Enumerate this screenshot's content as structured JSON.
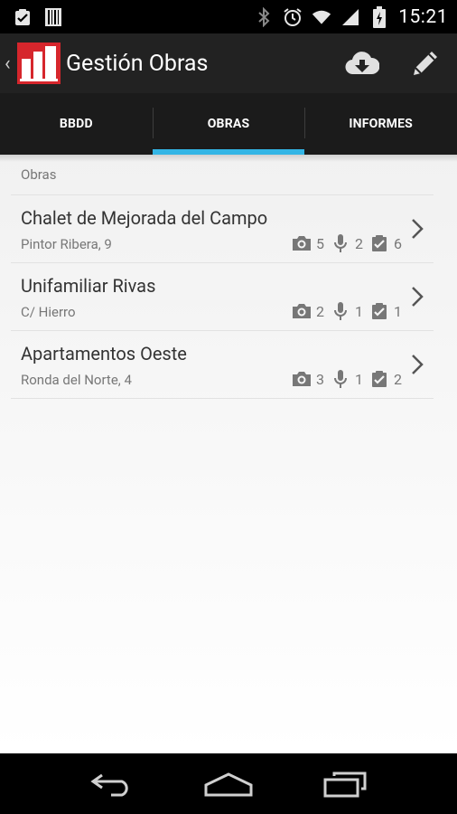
{
  "status_bar": {
    "time": "15:21",
    "left_icons": [
      "clipboard-check-icon",
      "barcode-icon"
    ],
    "right_icons": [
      "bluetooth-icon",
      "alarm-icon",
      "wifi-icon",
      "signal-icon",
      "battery-icon"
    ]
  },
  "action_bar": {
    "title": "Gestión Obras",
    "actions": [
      "download-cloud-icon",
      "pencil-icon"
    ]
  },
  "tabs": [
    {
      "label": "BBDD",
      "active": false
    },
    {
      "label": "OBRAS",
      "active": true
    },
    {
      "label": "INFORMES",
      "active": false
    }
  ],
  "section": {
    "header": "Obras"
  },
  "obras": [
    {
      "name": "Chalet de Mejorada del Campo",
      "address": "Pintor Ribera, 9",
      "photos": "5",
      "audio": "2",
      "tasks": "6"
    },
    {
      "name": "Unifamiliar Rivas",
      "address": "C/ Hierro",
      "photos": "2",
      "audio": "1",
      "tasks": "1"
    },
    {
      "name": "Apartamentos Oeste",
      "address": "Ronda del Norte, 4",
      "photos": "3",
      "audio": "1",
      "tasks": "2"
    }
  ],
  "colors": {
    "accent": "#33b5e5",
    "logo_red": "#d6262c",
    "action_bar": "#222222"
  }
}
